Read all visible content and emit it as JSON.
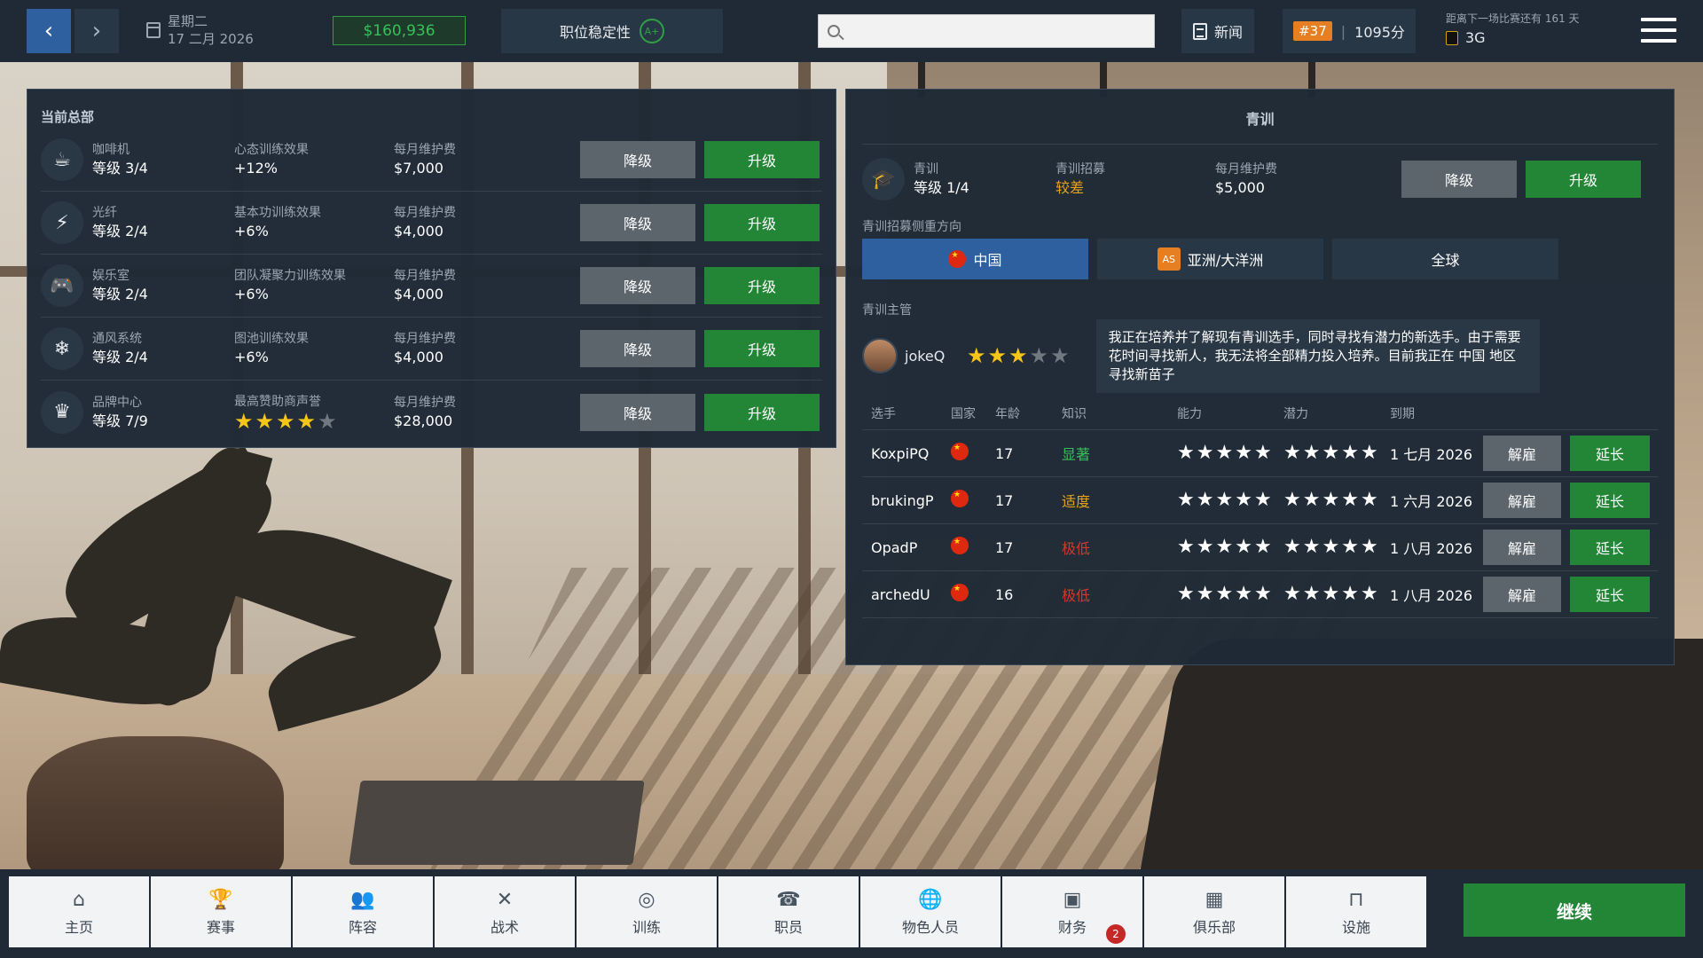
{
  "topbar": {
    "date_weekday": "星期二",
    "date_full": "17 二月 2026",
    "balance": "$160,936",
    "stability_label": "职位稳定性",
    "stability_grade": "A+",
    "search_placeholder": "",
    "news_label": "新闻",
    "rank": "#37",
    "points": "1095分",
    "next_match_label": "距离下一场比赛还有 161 天",
    "next_team": "3G"
  },
  "hq": {
    "title": "当前总部",
    "downgrade_label": "降级",
    "upgrade_label": "升级",
    "facilities": [
      {
        "name": "咖啡机",
        "level": "等级 3/4",
        "effect_label": "心态训练效果",
        "effect_value": "+12%",
        "cost_label": "每月维护费",
        "cost": "$7,000",
        "icon": "coffee-machine-icon"
      },
      {
        "name": "光纤",
        "level": "等级 2/4",
        "effect_label": "基本功训练效果",
        "effect_value": "+6%",
        "cost_label": "每月维护费",
        "cost": "$4,000",
        "icon": "fiber-icon"
      },
      {
        "name": "娱乐室",
        "level": "等级 2/4",
        "effect_label": "团队凝聚力训练效果",
        "effect_value": "+6%",
        "cost_label": "每月维护费",
        "cost": "$4,000",
        "icon": "game-room-icon"
      },
      {
        "name": "通风系统",
        "level": "等级 2/4",
        "effect_label": "图池训练效果",
        "effect_value": "+6%",
        "cost_label": "每月维护费",
        "cost": "$4,000",
        "icon": "ventilation-icon"
      },
      {
        "name": "品牌中心",
        "level": "等级 7/9",
        "effect_label": "最高赞助商声誉",
        "effect_stars": 4,
        "cost_label": "每月维护费",
        "cost": "$28,000",
        "icon": "brand-center-icon"
      }
    ]
  },
  "youth": {
    "title": "青训",
    "academy_name": "青训",
    "academy_level": "等级 1/4",
    "recruit_label": "青训招募",
    "recruit_value": "较差",
    "cost_label": "每月维护费",
    "cost": "$5,000",
    "downgrade_label": "降级",
    "upgrade_label": "升级",
    "focus_label": "青训招募侧重方向",
    "regions": [
      {
        "label": "中国",
        "active": true
      },
      {
        "label": "亚洲/大洋洲",
        "badge": "AS",
        "active": false
      },
      {
        "label": "全球",
        "active": false
      }
    ],
    "manager_label": "青训主管",
    "manager_name": "jokeQ",
    "manager_stars": 3,
    "manager_quote": "我正在培养并了解现有青训选手，同时寻找有潜力的新选手。由于需要花时间寻找新人，我无法将全部精力投入培养。目前我正在 中国 地区寻找新苗子",
    "columns": {
      "player": "选手",
      "nation": "国家",
      "age": "年龄",
      "knowledge": "知识",
      "ability": "能力",
      "potential": "潜力",
      "expiry": "到期"
    },
    "release_label": "解雇",
    "extend_label": "延长",
    "players": [
      {
        "name": "KoxpiPQ",
        "age": "17",
        "knowledge": "显著",
        "knowledge_color": "#35c15a",
        "expiry": "1 七月 2026"
      },
      {
        "name": "brukingP",
        "age": "17",
        "knowledge": "适度",
        "knowledge_color": "#e6a317",
        "expiry": "1 六月 2026"
      },
      {
        "name": "OpadP",
        "age": "17",
        "knowledge": "极低",
        "knowledge_color": "#d4382c",
        "expiry": "1 八月 2026"
      },
      {
        "name": "archedU",
        "age": "16",
        "knowledge": "极低",
        "knowledge_color": "#d4382c",
        "expiry": "1 八月 2026"
      }
    ]
  },
  "bottom_nav": {
    "items": [
      {
        "label": "主页",
        "icon": "home-icon"
      },
      {
        "label": "赛事",
        "icon": "trophy-icon"
      },
      {
        "label": "阵容",
        "icon": "roster-icon"
      },
      {
        "label": "战术",
        "icon": "tactics-icon"
      },
      {
        "label": "训练",
        "icon": "target-icon"
      },
      {
        "label": "职员",
        "icon": "staff-icon"
      },
      {
        "label": "物色人员",
        "icon": "scout-globe-icon"
      },
      {
        "label": "财务",
        "icon": "finance-icon"
      },
      {
        "label": "俱乐部",
        "icon": "club-building-icon"
      },
      {
        "label": "设施",
        "icon": "facility-icon"
      }
    ],
    "finance_badge": "2",
    "continue_label": "继续"
  },
  "colors": {
    "accent_blue": "#2e5f9e",
    "green": "#238636",
    "panel": "#1f2a36",
    "star": "#f5c518"
  }
}
